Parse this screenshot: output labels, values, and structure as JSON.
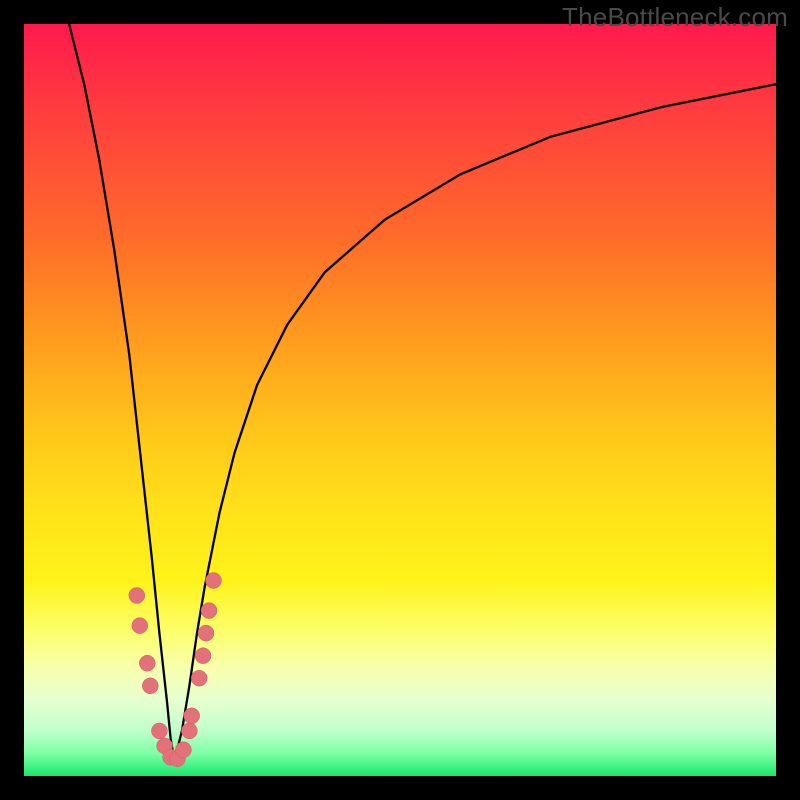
{
  "watermark": "TheBottleneck.com",
  "colors": {
    "bg": "#000000",
    "curve": "#000000",
    "marker_fill": "#e2717a",
    "marker_stroke": "#d05c66"
  },
  "chart_data": {
    "type": "line",
    "title": "",
    "xlabel": "",
    "ylabel": "",
    "xlim": [
      0,
      100
    ],
    "ylim": [
      0,
      100
    ],
    "grid": false,
    "legend": false,
    "description": "Two bottleneck curves that plunge toward zero near x≈20 from the left and rise asymptotically toward the right, over a red-to-green vertical gradient indicating severity. Salmon markers cluster around the minimum.",
    "series": [
      {
        "name": "left-branch",
        "x": [
          6,
          8,
          10,
          12,
          14,
          15,
          16,
          17,
          18,
          19,
          19.5,
          20
        ],
        "y": [
          100,
          92,
          82,
          70,
          56,
          47,
          38,
          29,
          19,
          10,
          5,
          2
        ]
      },
      {
        "name": "right-branch",
        "x": [
          20,
          21,
          22,
          23,
          24,
          26,
          28,
          31,
          35,
          40,
          48,
          58,
          70,
          85,
          100
        ],
        "y": [
          2,
          6,
          12,
          19,
          25,
          35,
          43,
          52,
          60,
          67,
          74,
          80,
          85,
          89,
          92
        ]
      }
    ],
    "markers": [
      {
        "x": 15.0,
        "y": 24
      },
      {
        "x": 15.4,
        "y": 20
      },
      {
        "x": 16.4,
        "y": 15
      },
      {
        "x": 16.8,
        "y": 12
      },
      {
        "x": 18.0,
        "y": 6
      },
      {
        "x": 18.7,
        "y": 4
      },
      {
        "x": 19.5,
        "y": 2.5
      },
      {
        "x": 20.4,
        "y": 2.3
      },
      {
        "x": 21.2,
        "y": 3.5
      },
      {
        "x": 22.0,
        "y": 6
      },
      {
        "x": 22.3,
        "y": 8
      },
      {
        "x": 23.3,
        "y": 13
      },
      {
        "x": 23.8,
        "y": 16
      },
      {
        "x": 24.2,
        "y": 19
      },
      {
        "x": 24.6,
        "y": 22
      },
      {
        "x": 25.2,
        "y": 26
      }
    ]
  }
}
